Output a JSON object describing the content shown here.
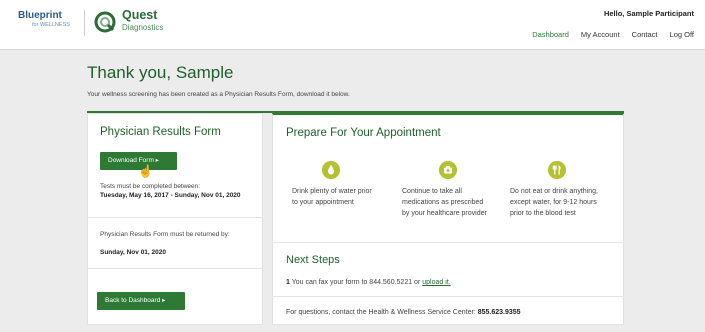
{
  "header": {
    "blueprint_main": "Blueprint",
    "blueprint_sub": "for WELLNESS",
    "quest_name": "Quest",
    "quest_sub": "Diagnostics",
    "greeting": "Hello, Sample Participant",
    "nav": [
      "Dashboard",
      "My Account",
      "Contact",
      "Log Off"
    ],
    "active_nav": "Dashboard"
  },
  "page": {
    "title": "Thank you, Sample",
    "subtitle": "Your wellness screening has been created as a Physician Results Form, download it below."
  },
  "left_card": {
    "title": "Physician Results Form",
    "download_label": "Download Form ▸",
    "tests_label": "Tests must be completed between:",
    "tests_dates": "Tuesday, May 16, 2017 - Sunday, Nov 01, 2020",
    "return_label": "Physician Results Form must be returned by:",
    "return_date": "Sunday, Nov 01, 2020",
    "back_label": "Back to Dashboard ▸"
  },
  "right_card": {
    "title": "Prepare For Your Appointment",
    "tips": [
      {
        "icon": "water-drop-icon",
        "text": "Drink plenty of water prior to your appointment"
      },
      {
        "icon": "medication-icon",
        "text": "Continue to take all medications as prescribed by your healthcare provider"
      },
      {
        "icon": "no-food-icon",
        "text": "Do not eat or drink anything, except water, for 9-12 hours prior to the blood test"
      }
    ],
    "next_title": "Next Steps",
    "fax_step": "1",
    "fax_text": "You can fax your form to 844.560.5221 or",
    "upload_link": "upload it.",
    "questions_text": "For questions, contact the Health & Wellness Service Center:",
    "phone": "855.623.9355"
  },
  "colors": {
    "brand_green": "#2e7a35",
    "title_green": "#1f5f2a",
    "tip_icon": "#b5c132",
    "background": "#ececec"
  }
}
